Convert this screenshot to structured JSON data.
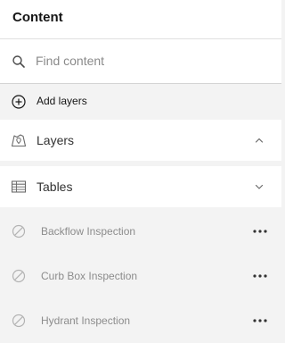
{
  "header": {
    "title": "Content"
  },
  "search": {
    "placeholder": "Find content",
    "value": ""
  },
  "add_layers": {
    "label": "Add layers"
  },
  "sections": {
    "layers": {
      "label": "Layers",
      "state": "expanded"
    },
    "tables": {
      "label": "Tables",
      "state": "collapsed"
    }
  },
  "tables": [
    {
      "label": "Backflow Inspection",
      "status": "unavailable"
    },
    {
      "label": "Curb Box Inspection",
      "status": "unavailable"
    },
    {
      "label": "Hydrant Inspection",
      "status": "unavailable"
    }
  ],
  "icons": {
    "search": "search-icon",
    "add": "plus-circle-icon",
    "layers": "layers-icon",
    "tables": "table-icon",
    "expand": "chevron-up-icon",
    "collapse": "chevron-down-icon",
    "unavailable": "circle-slash-icon",
    "more": "ellipsis-icon"
  },
  "colors": {
    "background": "#f3f3f3",
    "surface": "#ffffff",
    "text": "#323232",
    "muted": "#8c8c8c"
  }
}
